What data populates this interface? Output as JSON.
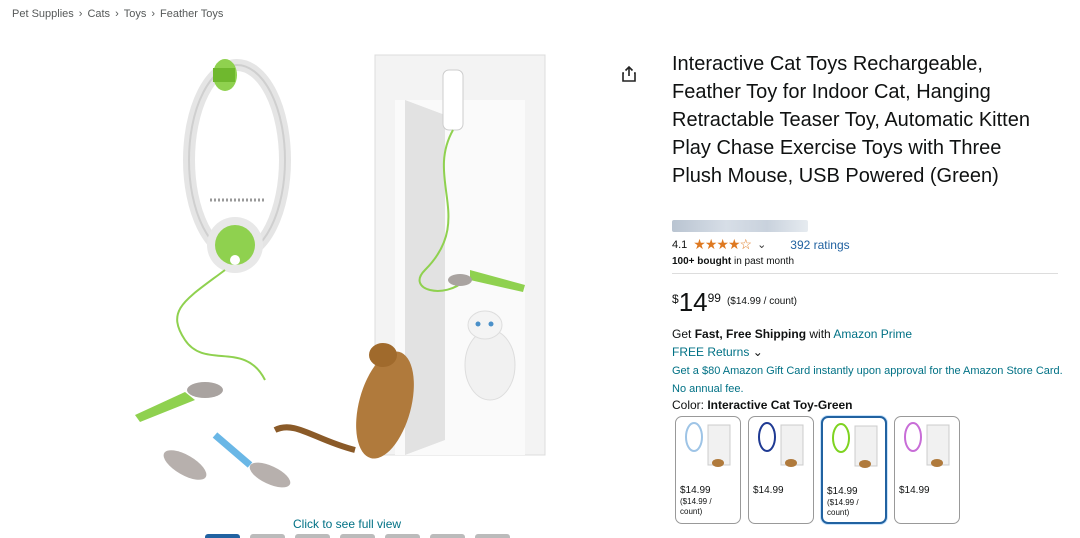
{
  "breadcrumb": {
    "items": [
      "Pet Supplies",
      "Cats",
      "Toys",
      "Feather Toys"
    ],
    "separator": "›"
  },
  "gallery": {
    "see_full_view": "Click to see full view",
    "thumbnail_count": 7
  },
  "product": {
    "title": "Interactive Cat Toys Rechargeable, Feather Toy for Indoor Cat, Hanging Retractable Teaser Toy, Automatic Kitten Play Chase Exercise Toys with Three Plush Mouse, USB Powered (Green)",
    "rating_value": "4.1",
    "stars": "★★★★☆",
    "rating_fraction": 0.82,
    "ratings_count": "392 ratings",
    "bought_bold": "100+ bought",
    "bought_rest": " in past month"
  },
  "price": {
    "symbol": "$",
    "whole": "14",
    "fraction": "99",
    "unit_price": "($14.99 / count)"
  },
  "shipping": {
    "get": "Get ",
    "bold": "Fast, Free Shipping",
    "with": " with ",
    "prime_link": "Amazon Prime",
    "returns": "FREE Returns",
    "promo": "Get a $80 Amazon Gift Card instantly upon approval for the Amazon Store Card. No annual fee."
  },
  "color": {
    "label": "Color: ",
    "selected": "Interactive Cat Toy-Green",
    "options": [
      {
        "price": "$14.99",
        "unit": "($14.99 / count)",
        "accent": "#9ec4e6"
      },
      {
        "price": "$14.99",
        "unit": "",
        "accent": "#1f3a93"
      },
      {
        "price": "$14.99",
        "unit": "($14.99 / count)",
        "accent": "#7ed321"
      },
      {
        "price": "$14.99",
        "unit": "",
        "accent": "#c86dd7"
      }
    ]
  },
  "colors": {
    "link": "#007185",
    "link_blue": "#2162a1",
    "star": "#de7921",
    "toy_green": "#8fd14f"
  },
  "icons": {
    "share": "share-icon",
    "chevron": "chevron-down-icon"
  }
}
